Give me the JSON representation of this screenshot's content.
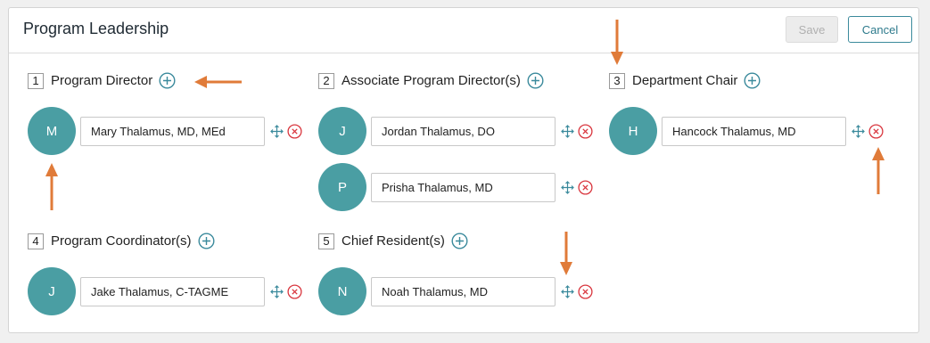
{
  "header": {
    "title": "Program Leadership",
    "save_label": "Save",
    "cancel_label": "Cancel"
  },
  "sections": [
    {
      "number": "1",
      "label": "Program Director",
      "members": [
        {
          "initial": "M",
          "name": "Mary Thalamus, MD, MEd"
        }
      ]
    },
    {
      "number": "2",
      "label": "Associate Program Director(s)",
      "members": [
        {
          "initial": "J",
          "name": "Jordan Thalamus, DO"
        },
        {
          "initial": "P",
          "name": "Prisha Thalamus, MD"
        }
      ]
    },
    {
      "number": "3",
      "label": "Department Chair",
      "members": [
        {
          "initial": "H",
          "name": "Hancock Thalamus, MD"
        }
      ]
    },
    {
      "number": "4",
      "label": "Program Coordinator(s)",
      "members": [
        {
          "initial": "J",
          "name": "Jake Thalamus, C-TAGME"
        }
      ]
    },
    {
      "number": "5",
      "label": "Chief Resident(s)",
      "members": [
        {
          "initial": "N",
          "name": "Noah Thalamus, MD"
        }
      ]
    }
  ],
  "icons": {
    "add": "plus-circle-icon",
    "move": "move-arrows-icon",
    "remove": "x-circle-icon"
  },
  "colors": {
    "accent": "#3b8a9c",
    "avatar": "#4a9ea3",
    "remove": "#d9363e",
    "annotation_arrow": "#e07b39"
  }
}
